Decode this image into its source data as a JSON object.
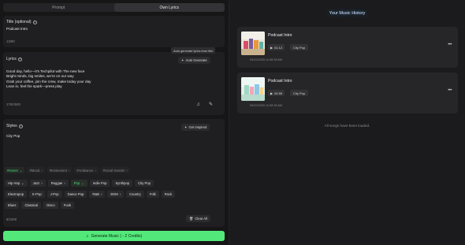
{
  "tabs": [
    "Prompt",
    "Own Lyrics"
  ],
  "title_section": {
    "label": "Title (optional)",
    "value": "Podcast Intro",
    "count": "13/80"
  },
  "lyrics_section": {
    "label": "Lyrics",
    "tooltip": "Auto generate lyrics from title",
    "auto_generate_label": "Auto Generate",
    "text": "Good day, hello—it's Techpilot with The new face\nBright minds, big smiles, we're on our way\nGrab your coffee, join the crew, make today your day\nLean in, feel the spark—press play",
    "count": "179/2500"
  },
  "styles_section": {
    "label": "Styles",
    "get_inspired_label": "Get Inspired",
    "value": "City Pop",
    "categories": [
      "#Genre",
      "#Mood",
      "#Instrument",
      "#Ambiance",
      "#Vocal Gender"
    ],
    "chip_rows": [
      [
        "Hip Hop",
        "Jazz",
        "Reggae",
        "Pop",
        "Indie Pop",
        "Synthpop",
        "City Pop"
      ],
      [
        "Electropop",
        "K-Pop",
        "J-Pop",
        "Dance Pop",
        "R&B",
        "EDM",
        "Country",
        "Folk",
        "Rock"
      ],
      [
        "Blues",
        "Classical",
        "Disco",
        "Funk"
      ]
    ],
    "count": "8/1000",
    "clear_all_label": "Clear All"
  },
  "generate_button_label": "Generate Music ( - 2 Credits)",
  "history": {
    "title": "Your Music History",
    "songs": [
      {
        "title": "Podcast Intro",
        "duration": "01:12",
        "style": "City Pop",
        "date": "09/22/2025 11:08:35 AM"
      },
      {
        "title": "Podcast Intro",
        "duration": "00:55",
        "style": "City Pop",
        "date": "09/22/2025 11:08:35 AM"
      }
    ],
    "all_loaded": "All songs have been loaded."
  },
  "colors": {
    "accent_green": "#53e97a",
    "glow_blue": "#5aa0ff"
  }
}
